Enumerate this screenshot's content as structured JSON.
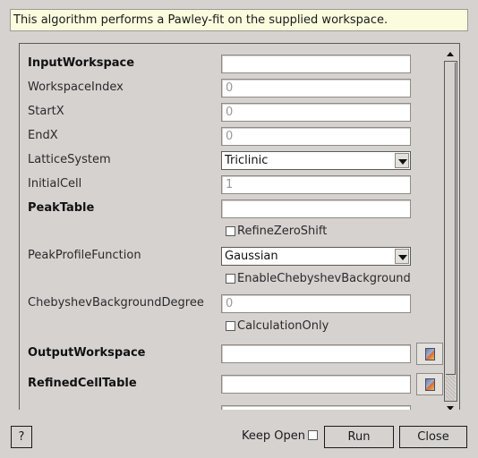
{
  "description": "This algorithm performs a Pawley-fit on the supplied workspace.",
  "rows": [
    {
      "label": "InputWorkspace",
      "value": ""
    },
    {
      "label": "WorkspaceIndex",
      "value": "0"
    },
    {
      "label": "StartX",
      "value": "0"
    },
    {
      "label": "EndX",
      "value": "0"
    },
    {
      "label": "LatticeSystem",
      "value": "Triclinic"
    },
    {
      "label": "InitialCell",
      "value": "1"
    },
    {
      "label": "PeakTable",
      "value": ""
    },
    {
      "label": "RefineZeroShift"
    },
    {
      "label": "PeakProfileFunction",
      "value": "Gaussian"
    },
    {
      "label": "EnableChebyshevBackground"
    },
    {
      "label": "ChebyshevBackgroundDegree",
      "value": "0"
    },
    {
      "label": "CalculationOnly"
    },
    {
      "label": "OutputWorkspace",
      "value": ""
    },
    {
      "label": "RefinedCellTable",
      "value": ""
    }
  ],
  "footer": {
    "help_label": "?",
    "keep_open_label": "Keep Open",
    "run_label": "Run",
    "close_label": "Close"
  }
}
